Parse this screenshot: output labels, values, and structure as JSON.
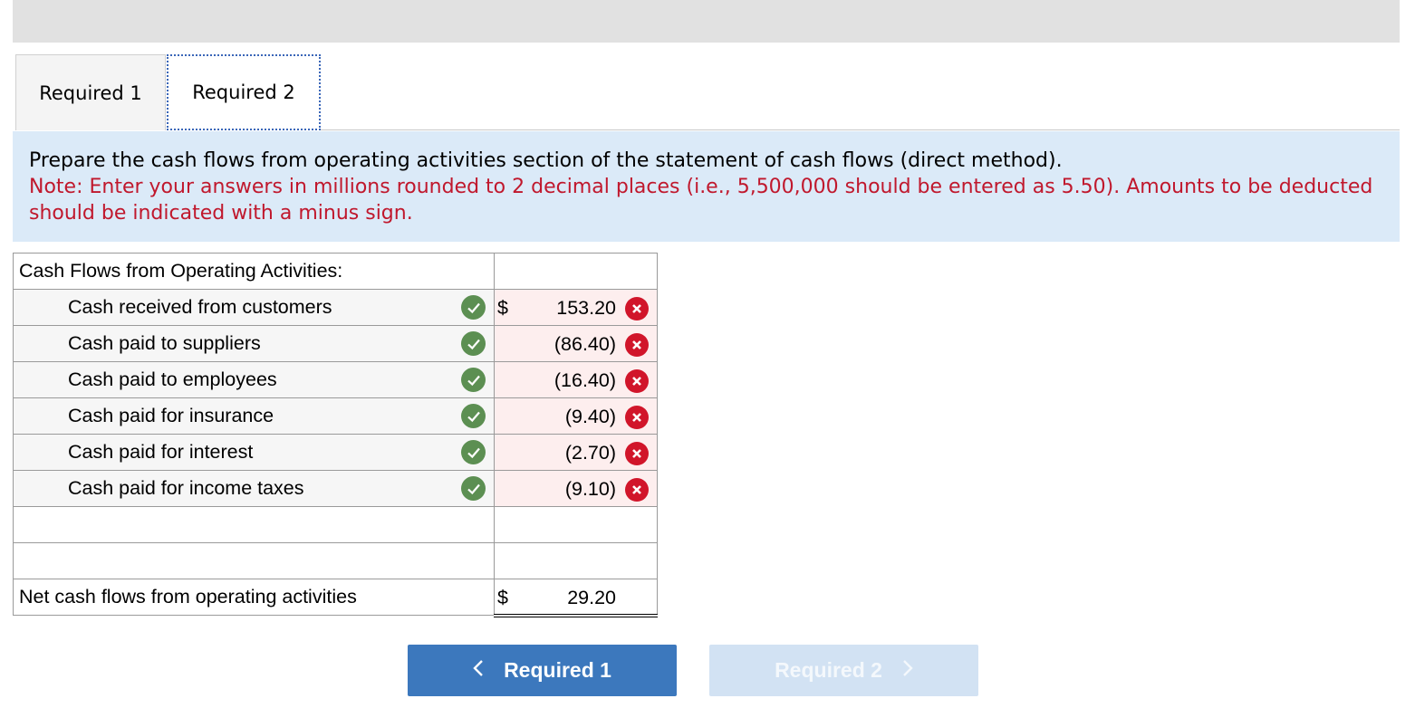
{
  "tabs": [
    {
      "label": "Required 1"
    },
    {
      "label": "Required 2"
    }
  ],
  "instructions": {
    "main": "Prepare the cash flows from operating activities section of the statement of cash flows (direct method).",
    "note": "Note: Enter your answers in millions rounded to 2 decimal places (i.e., 5,500,000 should be entered as 5.50). Amounts to be deducted should be indicated with a minus sign."
  },
  "table": {
    "header": "Cash Flows from Operating Activities:",
    "rows": [
      {
        "label": "Cash received from customers",
        "dollar": "$",
        "value": "153.20"
      },
      {
        "label": "Cash paid to suppliers",
        "dollar": "",
        "value": "(86.40)"
      },
      {
        "label": "Cash paid to employees",
        "dollar": "",
        "value": "(16.40)"
      },
      {
        "label": "Cash paid for insurance",
        "dollar": "",
        "value": "(9.40)"
      },
      {
        "label": "Cash paid for interest",
        "dollar": "",
        "value": "(2.70)"
      },
      {
        "label": "Cash paid for income taxes",
        "dollar": "",
        "value": "(9.10)"
      }
    ],
    "total": {
      "label": "Net cash flows from operating activities",
      "dollar": "$",
      "value": "29.20"
    }
  },
  "nav": {
    "prev_label": "Required 1",
    "next_label": "Required 2"
  },
  "colors": {
    "correct": "#5c8f52",
    "incorrect": "#d1152a",
    "note_text": "#c0182d",
    "primary_button": "#3c78bd"
  }
}
